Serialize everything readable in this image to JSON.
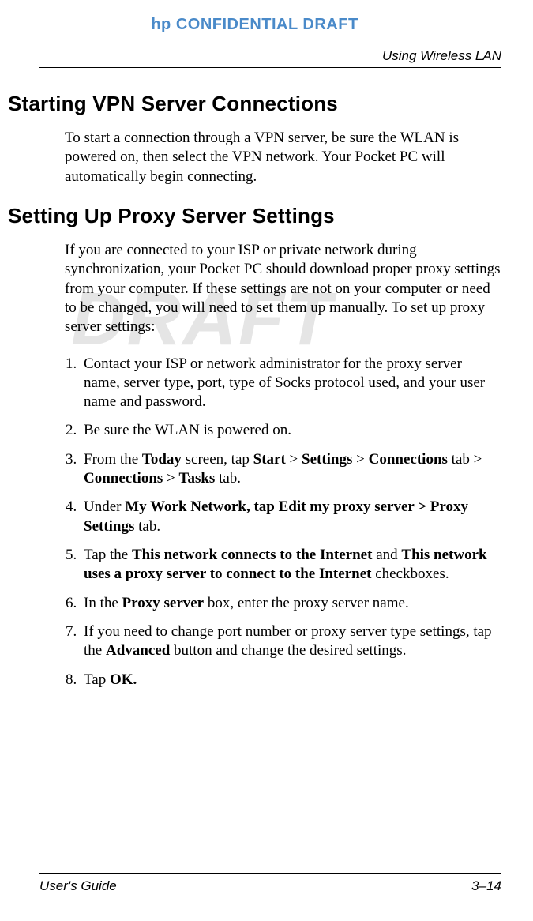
{
  "header": {
    "confidential": "hp CONFIDENTIAL DRAFT",
    "running_head": "Using Wireless LAN"
  },
  "watermark": "DRAFT",
  "section1": {
    "title": "Starting VPN Server Connections",
    "para": "To start a connection through a VPN server, be sure the WLAN is powered on, then select the VPN network. Your Pocket PC will automatically begin connecting."
  },
  "section2": {
    "title": "Setting Up Proxy Server Settings",
    "intro": "If you are connected to your ISP or private network during synchronization, your Pocket PC should download proper proxy settings from your computer. If these settings are not on your computer or need to be changed, you will need to set them up manually. To set up proxy server settings:",
    "steps": {
      "s1": "Contact your ISP or network administrator for the proxy server name, server type, port, type of Socks protocol used, and your user name and password.",
      "s2": "Be sure the WLAN is powered on.",
      "s3": {
        "t1": "From the ",
        "b1": "Today",
        "t2": " screen, tap ",
        "b2": "Start",
        "t3": " > ",
        "b3": "Settings",
        "t4": " > ",
        "b4": "Connections",
        "t5": " tab > ",
        "b5": "Connections",
        "t6": " > ",
        "b6": "Tasks",
        "t7": " tab."
      },
      "s4": {
        "t1": "Under ",
        "b1": "My Work Network, tap Edit my proxy server > Proxy Settings",
        "t2": " tab."
      },
      "s5": {
        "t1": "Tap the ",
        "b1": "This network connects to the Internet",
        "t2": " and ",
        "b2": "This network uses a proxy server to connect to the Internet",
        "t3": " checkboxes."
      },
      "s6": {
        "t1": "In the ",
        "b1": "Proxy server",
        "t2": " box, enter the proxy server name."
      },
      "s7": {
        "t1": "If you need to change port number or proxy server type settings, tap the ",
        "b1": "Advanced",
        "t2": " button and change the desired settings."
      },
      "s8": {
        "t1": "Tap ",
        "b1": "OK."
      }
    }
  },
  "footer": {
    "left": "User's Guide",
    "right": "3–14"
  }
}
